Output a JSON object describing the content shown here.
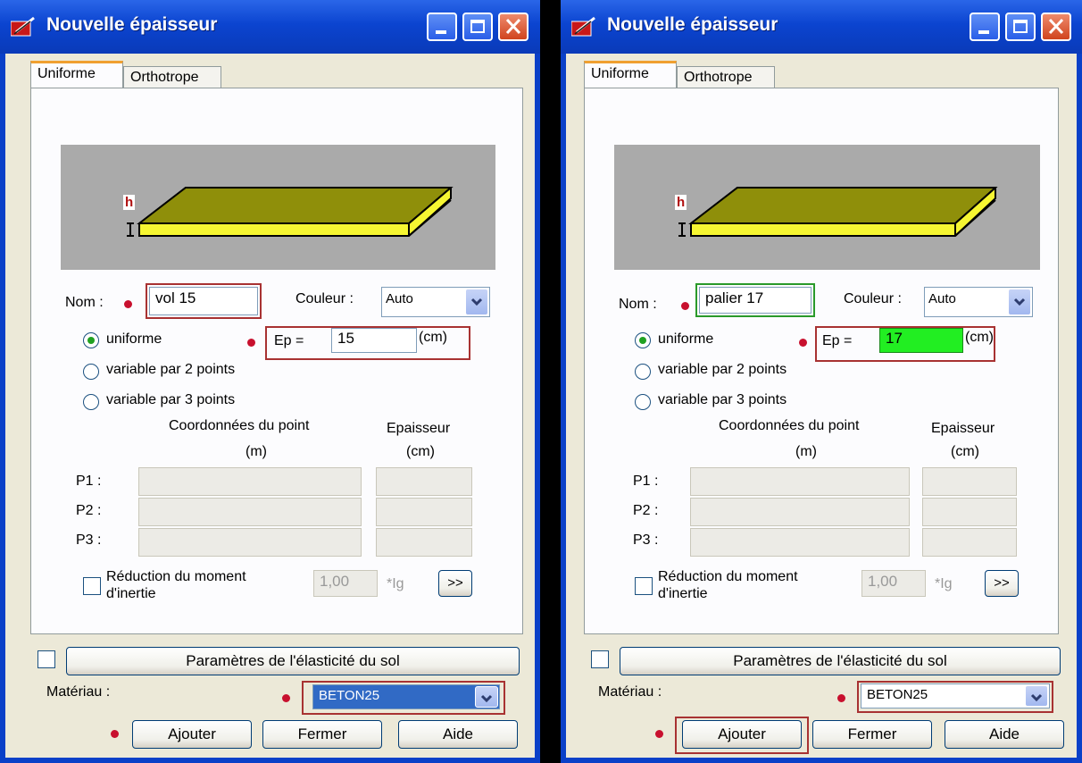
{
  "windows": [
    {
      "title": "Nouvelle épaisseur",
      "tabs": [
        "Uniforme",
        "Orthotrope"
      ],
      "preview_h": "h",
      "nom_label": "Nom :",
      "nom_value": "vol 15",
      "couleur_label": "Couleur :",
      "couleur_value": "Auto",
      "radio_uniforme": "uniforme",
      "radio_2pts": "variable par 2 points",
      "radio_3pts": "variable par 3 points",
      "ep_label": "Ep =",
      "ep_value": "15",
      "ep_unit": "(cm)",
      "coord_header_1": "Coordonnées du point",
      "coord_header_2": "(m)",
      "epaisseur_header_1": "Epaisseur",
      "epaisseur_header_2": "(cm)",
      "points": [
        "P1 :",
        "P2 :",
        "P3 :"
      ],
      "reduction_label_1": "Réduction du moment",
      "reduction_label_2": "d'inertie",
      "reduction_value": "1,00",
      "reduction_unit": "*Ig",
      "more_button": ">>",
      "elasticite_button": "Paramètres de l'élasticité du sol",
      "materiau_label": "Matériau :",
      "materiau_value": "BETON25",
      "btn_ajouter": "Ajouter",
      "btn_fermer": "Fermer",
      "btn_aide": "Aide",
      "ep_field_color": "#ffffff"
    },
    {
      "title": "Nouvelle épaisseur",
      "tabs": [
        "Uniforme",
        "Orthotrope"
      ],
      "preview_h": "h",
      "nom_label": "Nom :",
      "nom_value": "palier 17",
      "couleur_label": "Couleur :",
      "couleur_value": "Auto",
      "radio_uniforme": "uniforme",
      "radio_2pts": "variable par 2 points",
      "radio_3pts": "variable par 3 points",
      "ep_label": "Ep =",
      "ep_value": "17",
      "ep_unit": "(cm)",
      "coord_header_1": "Coordonnées du point",
      "coord_header_2": "(m)",
      "epaisseur_header_1": "Epaisseur",
      "epaisseur_header_2": "(cm)",
      "points": [
        "P1 :",
        "P2 :",
        "P3 :"
      ],
      "reduction_label_1": "Réduction du moment",
      "reduction_label_2": "d'inertie",
      "reduction_value": "1,00",
      "reduction_unit": "*Ig",
      "more_button": ">>",
      "elasticite_button": "Paramètres de l'élasticité du sol",
      "materiau_label": "Matériau :",
      "materiau_value": "BETON25",
      "btn_ajouter": "Ajouter",
      "btn_fermer": "Fermer",
      "btn_aide": "Aide",
      "ep_field_color": "#22ee22"
    }
  ]
}
